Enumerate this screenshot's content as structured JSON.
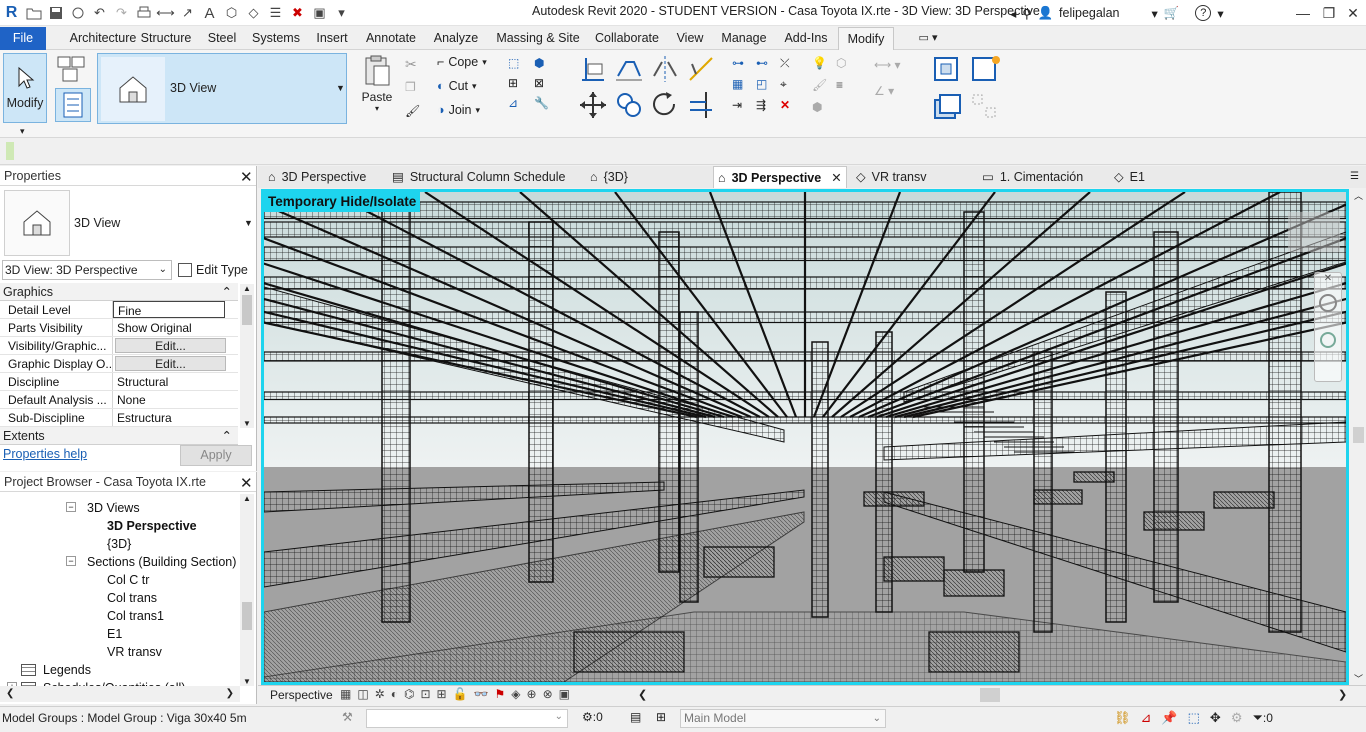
{
  "window": {
    "title": "Autodesk Revit 2020 - STUDENT VERSION - Casa Toyota IX.rte - 3D View: 3D Perspective",
    "username": "felipegalan"
  },
  "menu": {
    "tabs": [
      "File",
      "Architecture",
      "Structure",
      "Steel",
      "Systems",
      "Insert",
      "Annotate",
      "Analyze",
      "Massing & Site",
      "Collaborate",
      "View",
      "Manage",
      "Add-Ins",
      "Modify"
    ],
    "active": "Modify"
  },
  "ribbon": {
    "modify_label": "Modify",
    "type_selector": "3D View",
    "paste_label": "Paste",
    "cope_label": "Cope",
    "cut_label": "Cut",
    "join_label": "Join"
  },
  "view_tabs": [
    {
      "label": "3D Perspective",
      "icon": "3d-house-icon"
    },
    {
      "label": "Structural Column Schedule",
      "icon": "schedule-icon"
    },
    {
      "label": "{3D}",
      "icon": "3d-house-icon"
    },
    {
      "label": "3D Perspective",
      "icon": "3d-house-icon",
      "active": true
    },
    {
      "label": "VR transv",
      "icon": "section-icon"
    },
    {
      "label": "1. Cimentación",
      "icon": "plan-icon"
    },
    {
      "label": "E1",
      "icon": "section-icon"
    }
  ],
  "properties": {
    "header": "Properties",
    "type_name": "3D View",
    "instance_selector": "3D View: 3D Perspective",
    "edit_type": "Edit Type",
    "group_graphics": "Graphics",
    "group_extents": "Extents",
    "rows": [
      {
        "key": "Detail Level",
        "value": "Fine"
      },
      {
        "key": "Parts Visibility",
        "value": "Show Original"
      },
      {
        "key": "Visibility/Graphic...",
        "value": "Edit..."
      },
      {
        "key": "Graphic Display O...",
        "value": "Edit..."
      },
      {
        "key": "Discipline",
        "value": "Structural"
      },
      {
        "key": "Default Analysis ...",
        "value": "None"
      },
      {
        "key": "Sub-Discipline",
        "value": "Estructura"
      }
    ],
    "help_link": "Properties help",
    "apply_label": "Apply"
  },
  "browser": {
    "header": "Project Browser - Casa Toyota IX.rte",
    "items": [
      {
        "label": "3D Views",
        "level": 1,
        "expander": "−"
      },
      {
        "label": "3D Perspective",
        "level": 2,
        "bold": true
      },
      {
        "label": "{3D}",
        "level": 2
      },
      {
        "label": "Sections (Building Section)",
        "level": 1,
        "expander": "−"
      },
      {
        "label": "Col C tr",
        "level": 2
      },
      {
        "label": "Col trans",
        "level": 2
      },
      {
        "label": "Col trans1",
        "level": 2
      },
      {
        "label": "E1",
        "level": 2
      },
      {
        "label": "VR transv",
        "level": 2
      },
      {
        "label": "Legends",
        "level": 0
      },
      {
        "label": "Schedules/Quantities (all)",
        "level": 0,
        "expander": "+"
      }
    ]
  },
  "viewport": {
    "banner": "Temporary Hide/Isolate",
    "accent": "#1ed4ee"
  },
  "view_control_bar": {
    "scale_label": "Perspective"
  },
  "status": {
    "message": "Model Groups : Model Group : Viga 30x40 5m",
    "workset_count": ":0",
    "design_option": "Main Model",
    "filter_count": ":0"
  }
}
